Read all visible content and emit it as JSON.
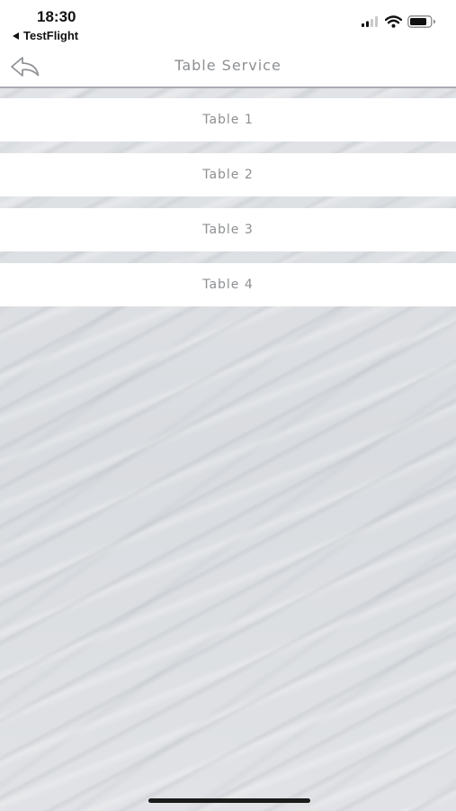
{
  "status_bar": {
    "time": "18:30",
    "back_app_label": "TestFlight",
    "icons": [
      "cellular-signal-icon",
      "wifi-icon",
      "battery-icon"
    ]
  },
  "nav": {
    "back_icon": "reply-arrow-icon",
    "title": "Table Service"
  },
  "tables": [
    {
      "label": "Table 1"
    },
    {
      "label": "Table 2"
    },
    {
      "label": "Table 3"
    },
    {
      "label": "Table 4"
    }
  ],
  "colors": {
    "background": "#dfe1e4",
    "row_background": "#ffffff",
    "text_gray": "#8d8f92"
  }
}
